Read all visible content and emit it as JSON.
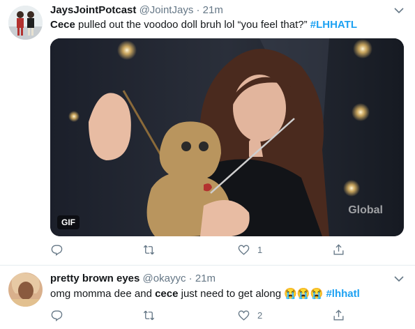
{
  "tweets": [
    {
      "display_name": "JaysJointPotcast",
      "handle": "@JointJays",
      "separator": "·",
      "time": "21m",
      "text_parts": [
        "Cece",
        " pulled out the voodoo doll bruh lol “you feel that?” ",
        "#LHHATL"
      ],
      "media": {
        "type_badge": "GIF",
        "watermark": "Global"
      },
      "actions": {
        "reply": "",
        "retweet": "",
        "like": "1",
        "share": ""
      },
      "icons": [
        "chevron-down-icon",
        "reply-icon",
        "retweet-icon",
        "heart-icon",
        "share-icon"
      ]
    },
    {
      "display_name": "pretty brown eyes",
      "handle": "@okayyc",
      "separator": "·",
      "time": "21m",
      "text_parts": [
        "omg momma dee and ",
        "cece",
        " just need to get along ",
        "😭😭😭",
        " ",
        "#lhhatl"
      ],
      "actions": {
        "reply": "",
        "retweet": "",
        "like": "2",
        "share": ""
      },
      "icons": [
        "chevron-down-icon",
        "reply-icon",
        "retweet-icon",
        "heart-icon",
        "share-icon"
      ]
    }
  ],
  "colors": {
    "link": "#1da1f2",
    "secondary": "#657786",
    "border": "#e6ecf0"
  }
}
